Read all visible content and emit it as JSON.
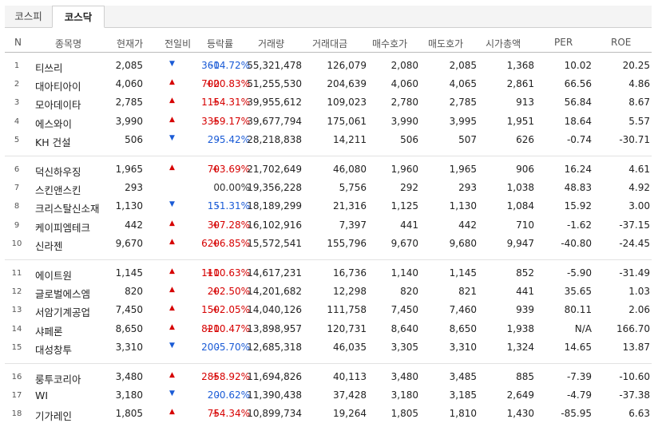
{
  "tabs": [
    {
      "label": "코스피"
    },
    {
      "label": "코스닥"
    }
  ],
  "columns": {
    "n": "N",
    "name": "종목명",
    "current": "현재가",
    "change": "전일비",
    "rate": "등락률",
    "volume": "거래량",
    "amount": "거래대금",
    "bid": "매수호가",
    "ask": "매도호가",
    "market_cap": "시가총액",
    "per": "PER",
    "roe": "ROE"
  },
  "colors": {
    "up": "#d60000",
    "down": "#1a5bd6"
  },
  "rows": [
    {
      "n": "1",
      "name": "티쓰리",
      "current": "2,085",
      "dir": "down",
      "arrow": "▼",
      "change": "360",
      "rate": "-14.72%",
      "volume": "55,321,478",
      "amount": "126,079",
      "bid": "2,080",
      "ask": "2,085",
      "market_cap": "1,368",
      "per": "10.02",
      "roe": "20.25"
    },
    {
      "n": "2",
      "name": "대아티아이",
      "current": "4,060",
      "dir": "up",
      "arrow": "▲",
      "change": "700",
      "rate": "+20.83%",
      "volume": "51,255,530",
      "amount": "204,639",
      "bid": "4,060",
      "ask": "4,065",
      "market_cap": "2,861",
      "per": "66.56",
      "roe": "4.86"
    },
    {
      "n": "3",
      "name": "모아데이타",
      "current": "2,785",
      "dir": "up",
      "arrow": "▲",
      "change": "115",
      "rate": "+4.31%",
      "volume": "39,955,612",
      "amount": "109,023",
      "bid": "2,780",
      "ask": "2,785",
      "market_cap": "913",
      "per": "56.84",
      "roe": "8.67"
    },
    {
      "n": "4",
      "name": "에스와이",
      "current": "3,990",
      "dir": "up",
      "arrow": "▲",
      "change": "335",
      "rate": "+9.17%",
      "volume": "39,677,794",
      "amount": "175,061",
      "bid": "3,990",
      "ask": "3,995",
      "market_cap": "1,951",
      "per": "18.64",
      "roe": "5.57"
    },
    {
      "n": "5",
      "name": "KH 건설",
      "current": "506",
      "dir": "down",
      "arrow": "▼",
      "change": "29",
      "rate": "-5.42%",
      "volume": "28,218,838",
      "amount": "14,211",
      "bid": "506",
      "ask": "507",
      "market_cap": "626",
      "per": "-0.74",
      "roe": "-30.71"
    },
    {
      "n": "6",
      "name": "덕신하우징",
      "current": "1,965",
      "dir": "up",
      "arrow": "▲",
      "change": "70",
      "rate": "+3.69%",
      "volume": "21,702,649",
      "amount": "46,080",
      "bid": "1,960",
      "ask": "1,965",
      "market_cap": "906",
      "per": "16.24",
      "roe": "4.61"
    },
    {
      "n": "7",
      "name": "스킨앤스킨",
      "current": "293",
      "dir": "flat",
      "arrow": "",
      "change": "0",
      "rate": "0.00%",
      "volume": "19,356,228",
      "amount": "5,756",
      "bid": "292",
      "ask": "293",
      "market_cap": "1,038",
      "per": "48.83",
      "roe": "4.92"
    },
    {
      "n": "8",
      "name": "크리스탈신소재",
      "current": "1,130",
      "dir": "down",
      "arrow": "▼",
      "change": "15",
      "rate": "-1.31%",
      "volume": "18,189,299",
      "amount": "21,316",
      "bid": "1,125",
      "ask": "1,130",
      "market_cap": "1,084",
      "per": "15.92",
      "roe": "3.00"
    },
    {
      "n": "9",
      "name": "케이피엠테크",
      "current": "442",
      "dir": "up",
      "arrow": "▲",
      "change": "30",
      "rate": "+7.28%",
      "volume": "16,102,916",
      "amount": "7,397",
      "bid": "441",
      "ask": "442",
      "market_cap": "710",
      "per": "-1.62",
      "roe": "-37.15"
    },
    {
      "n": "10",
      "name": "신라젠",
      "current": "9,670",
      "dir": "up",
      "arrow": "▲",
      "change": "620",
      "rate": "+6.85%",
      "volume": "15,572,541",
      "amount": "155,796",
      "bid": "9,670",
      "ask": "9,680",
      "market_cap": "9,947",
      "per": "-40.80",
      "roe": "-24.45"
    },
    {
      "n": "11",
      "name": "에이트원",
      "current": "1,145",
      "dir": "up",
      "arrow": "▲",
      "change": "110",
      "rate": "+10.63%",
      "volume": "14,617,231",
      "amount": "16,736",
      "bid": "1,140",
      "ask": "1,145",
      "market_cap": "852",
      "per": "-5.90",
      "roe": "-31.49"
    },
    {
      "n": "12",
      "name": "글로벌에스엠",
      "current": "820",
      "dir": "up",
      "arrow": "▲",
      "change": "20",
      "rate": "+2.50%",
      "volume": "14,201,682",
      "amount": "12,298",
      "bid": "820",
      "ask": "821",
      "market_cap": "441",
      "per": "35.65",
      "roe": "1.03"
    },
    {
      "n": "13",
      "name": "서암기계공업",
      "current": "7,450",
      "dir": "up",
      "arrow": "▲",
      "change": "150",
      "rate": "+2.05%",
      "volume": "14,040,126",
      "amount": "111,758",
      "bid": "7,450",
      "ask": "7,460",
      "market_cap": "939",
      "per": "80.11",
      "roe": "2.06"
    },
    {
      "n": "14",
      "name": "샤페론",
      "current": "8,650",
      "dir": "up",
      "arrow": "▲",
      "change": "820",
      "rate": "+10.47%",
      "volume": "13,898,957",
      "amount": "120,731",
      "bid": "8,640",
      "ask": "8,650",
      "market_cap": "1,938",
      "per": "N/A",
      "roe": "166.70"
    },
    {
      "n": "15",
      "name": "대성창투",
      "current": "3,310",
      "dir": "down",
      "arrow": "▼",
      "change": "200",
      "rate": "-5.70%",
      "volume": "12,685,318",
      "amount": "46,035",
      "bid": "3,305",
      "ask": "3,310",
      "market_cap": "1,324",
      "per": "14.65",
      "roe": "13.87"
    },
    {
      "n": "16",
      "name": "룽투코리아",
      "current": "3,480",
      "dir": "up",
      "arrow": "▲",
      "change": "285",
      "rate": "+8.92%",
      "volume": "11,694,826",
      "amount": "40,113",
      "bid": "3,480",
      "ask": "3,485",
      "market_cap": "885",
      "per": "-7.39",
      "roe": "-10.60"
    },
    {
      "n": "17",
      "name": "WI",
      "current": "3,180",
      "dir": "down",
      "arrow": "▼",
      "change": "20",
      "rate": "-0.62%",
      "volume": "11,390,438",
      "amount": "37,428",
      "bid": "3,180",
      "ask": "3,185",
      "market_cap": "2,649",
      "per": "-4.79",
      "roe": "-37.38"
    },
    {
      "n": "18",
      "name": "기가레인",
      "current": "1,805",
      "dir": "up",
      "arrow": "▲",
      "change": "75",
      "rate": "+4.34%",
      "volume": "10,899,734",
      "amount": "19,264",
      "bid": "1,805",
      "ask": "1,810",
      "market_cap": "1,430",
      "per": "-85.95",
      "roe": "6.63"
    }
  ]
}
